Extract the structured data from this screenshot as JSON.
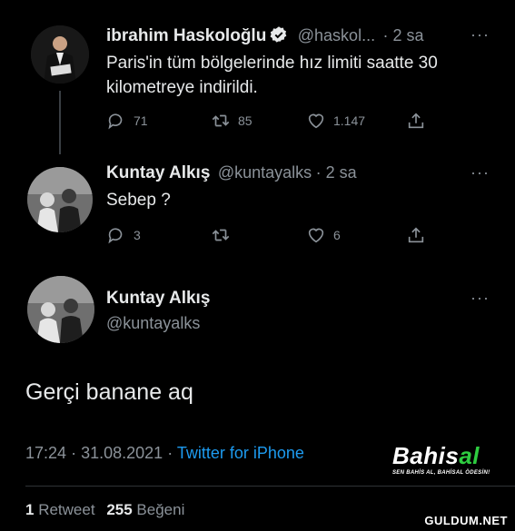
{
  "tweet1": {
    "name": "ibrahim Haskoloğlu",
    "handle": "@haskol...",
    "time": "· 2 sa",
    "text": "Paris'in tüm bölgelerinde hız limiti saatte 30 kilometreye indirildi.",
    "replies": "71",
    "retweets": "85",
    "likes": "1.147"
  },
  "tweet2": {
    "name": "Kuntay Alkış",
    "handle": "@kuntayalks",
    "time": "· 2 sa",
    "text": "Sebep ?",
    "replies": "3",
    "likes": "6"
  },
  "tweet3": {
    "name": "Kuntay Alkış",
    "handle": "@kuntayalks",
    "text": "Gerçi banane aq",
    "time": "17:24",
    "date": "31.08.2021",
    "source": "Twitter for iPhone",
    "retweet_count": "1",
    "retweet_label": "Retweet",
    "like_count": "255",
    "like_label": "Beğeni"
  },
  "more_label": "···",
  "separator": "·",
  "brand": {
    "name_main": "Bahis",
    "name_accent": "al",
    "tagline": "SEN BAHİS AL, BAHİSAL ÖDESİN!",
    "accent_color": "#2ecc40"
  },
  "watermark": "GULDUM.NET",
  "colors": {
    "background": "#000000",
    "text": "#e7e9ea",
    "muted": "#8b9299",
    "link": "#1d9bf0"
  }
}
